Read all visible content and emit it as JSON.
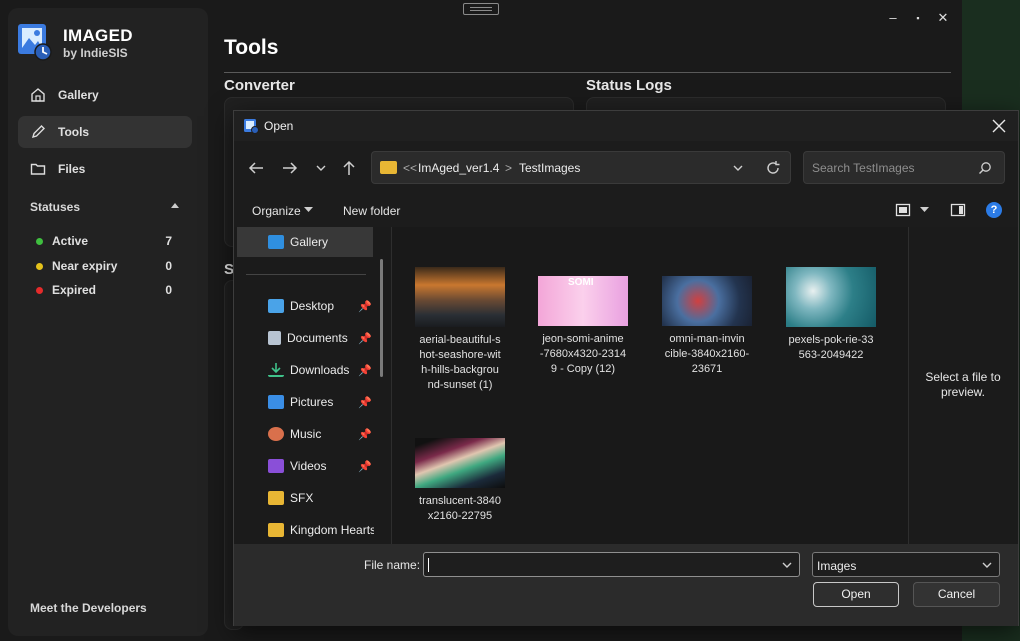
{
  "app": {
    "name": "IMAGED",
    "byline": "by IndieSIS",
    "window_controls": {
      "minimize": "–",
      "maximize": "▪",
      "close": "✕"
    }
  },
  "sidebar": {
    "items": [
      {
        "label": "Gallery",
        "icon": "home-icon"
      },
      {
        "label": "Tools",
        "icon": "pencil-icon"
      },
      {
        "label": "Files",
        "icon": "folder-icon"
      }
    ],
    "statuses_heading": "Statuses",
    "statuses": [
      {
        "label": "Active",
        "count": "7",
        "color": "#3fbf3f"
      },
      {
        "label": "Near expiry",
        "count": "0",
        "color": "#e5c21b"
      },
      {
        "label": "Expired",
        "count": "0",
        "color": "#e52b2b"
      }
    ],
    "footer_link": "Meet the Developers"
  },
  "main": {
    "title": "Tools",
    "sections": {
      "converter": "Converter",
      "status_logs": "Status Logs",
      "partial_heading": "S"
    }
  },
  "dialog": {
    "title": "Open",
    "breadcrumb": {
      "overflow": "<<",
      "parent": "ImAged_ver1.4",
      "separator": ">",
      "current": "TestImages"
    },
    "search_placeholder": "Search TestImages",
    "toolbar": {
      "organize": "Organize",
      "new_folder": "New folder"
    },
    "nav_items": [
      {
        "label": "Gallery",
        "icon": "gallery-icon",
        "pinned": false
      },
      {
        "label": "Desktop",
        "icon": "desktop-icon",
        "pinned": true
      },
      {
        "label": "Documents",
        "icon": "documents-icon",
        "pinned": true
      },
      {
        "label": "Downloads",
        "icon": "downloads-icon",
        "pinned": true
      },
      {
        "label": "Pictures",
        "icon": "pictures-icon",
        "pinned": true
      },
      {
        "label": "Music",
        "icon": "music-icon",
        "pinned": true
      },
      {
        "label": "Videos",
        "icon": "videos-icon",
        "pinned": true
      },
      {
        "label": "SFX",
        "icon": "folder-icon",
        "pinned": false
      },
      {
        "label": "Kingdom Hearts",
        "icon": "folder-icon",
        "pinned": false
      }
    ],
    "files": [
      {
        "name": "aerial-beautiful-shot-seashore-with-hills-background-sunset (1)",
        "name_lines": [
          "aerial-beautiful-s",
          "hot-seashore-wit",
          "h-hills-backgrou",
          "nd-sunset (1)"
        ]
      },
      {
        "name": "jeon-somi-anime-7680x4320-23149 - Copy (12)",
        "name_lines": [
          "jeon-somi-anime",
          "-7680x4320-2314",
          "9 - Copy (12)"
        ],
        "thumb_text": "SOMI"
      },
      {
        "name": "omni-man-invincible-3840x2160-23671",
        "name_lines": [
          "omni-man-invin",
          "cible-3840x2160-",
          "23671"
        ]
      },
      {
        "name": "pexels-pok-rie-33563-2049422",
        "name_lines": [
          "pexels-pok-rie-33",
          "563-2049422"
        ]
      },
      {
        "name": "translucent-3840x2160-22795",
        "name_lines": [
          "translucent-3840",
          "x2160-22795"
        ]
      }
    ],
    "preview_text": "Select a file to preview.",
    "file_name_label": "File name:",
    "file_name_value": "",
    "file_type": "Images",
    "open_button": "Open",
    "cancel_button": "Cancel",
    "help_glyph": "?"
  }
}
